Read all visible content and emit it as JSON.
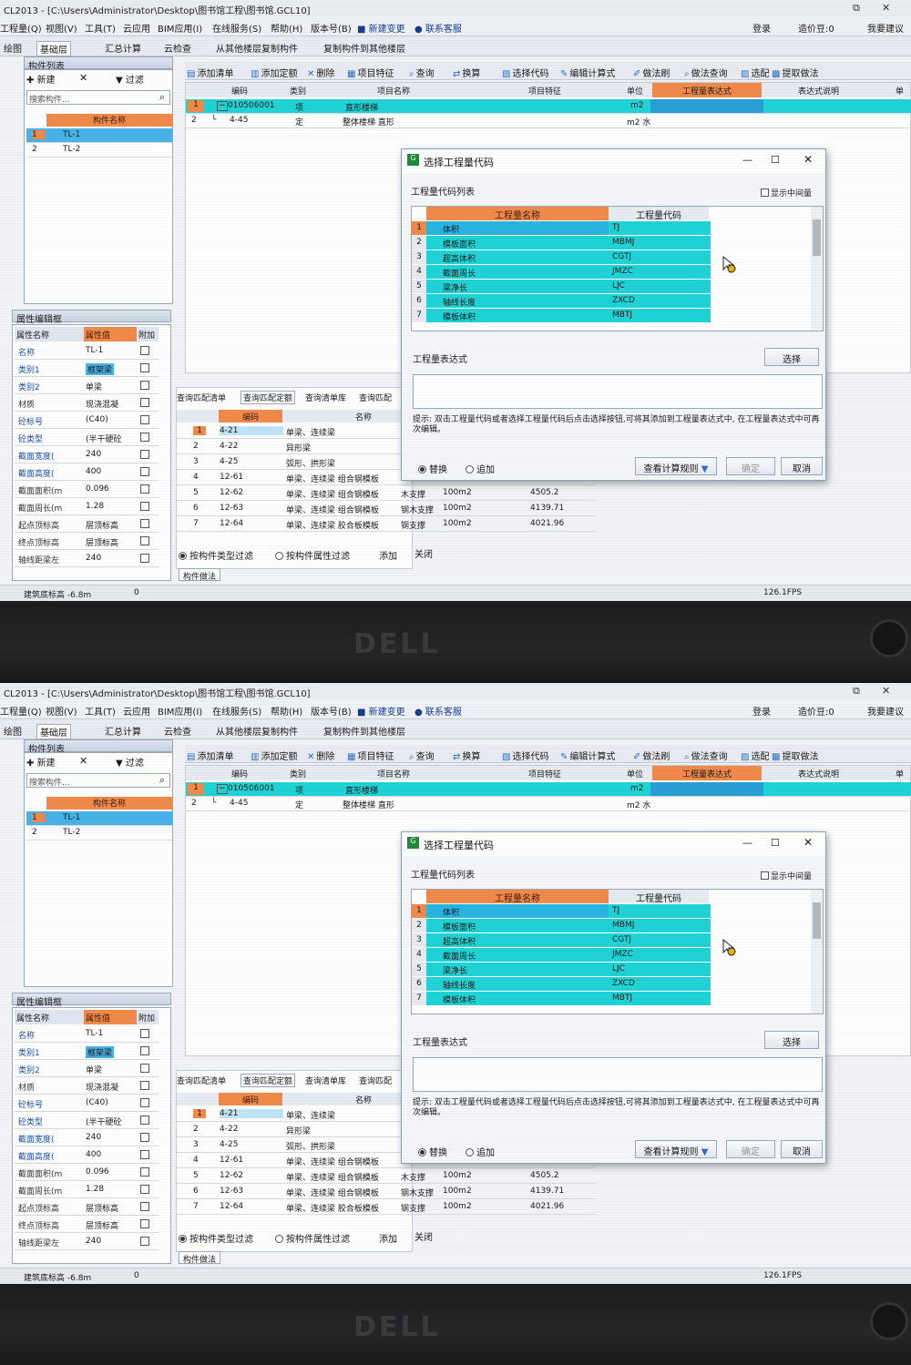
{
  "app": {
    "title": "CL2013 - [C:\\Users\\Administrator\\Desktop\\图书馆工程\\图书馆.GCL10]",
    "menus": [
      "工程量(Q)",
      "视图(V)",
      "工具(T)",
      "云应用",
      "BIM应用(I)",
      "在线服务(S)",
      "帮助(H)",
      "版本号(B)",
      "新建变更",
      "联系客服"
    ],
    "toolbar": {
      "draw": "绘图",
      "floor": "基础层",
      "sum": "汇总计算",
      "cloud_check": "云检查",
      "copy_from": "从其他楼层复制构件",
      "copy_to": "复制构件到其他楼层"
    },
    "account": {
      "login": "登录",
      "cost_beans": "造价豆:0",
      "feedback": "我要建议"
    }
  },
  "component_list": {
    "title": "构件列表",
    "new_label": "新建",
    "filter_label": "过滤",
    "search_placeholder": "搜索构件...",
    "column_header": "构件名称",
    "rows": [
      {
        "no": "1",
        "name": "TL-1"
      },
      {
        "no": "2",
        "name": "TL-2"
      }
    ]
  },
  "property_editor": {
    "title": "属性编辑框",
    "headers": {
      "name": "属性名称",
      "value": "属性值",
      "extra": "附加"
    },
    "rows": [
      {
        "name": "名称",
        "value": "TL-1"
      },
      {
        "name": "类别1",
        "value": "框架梁"
      },
      {
        "name": "类别2",
        "value": "单梁"
      },
      {
        "name": "材质",
        "value": "现浇混凝"
      },
      {
        "name": "砼标号",
        "value": "(C40)"
      },
      {
        "name": "砼类型",
        "value": "(半干硬砼"
      },
      {
        "name": "截面宽度(",
        "value": "240"
      },
      {
        "name": "截面高度(",
        "value": "400"
      },
      {
        "name": "截面面积(m",
        "value": "0.096"
      },
      {
        "name": "截面周长(m",
        "value": "1.28"
      },
      {
        "name": "起点顶标高",
        "value": "层顶标高"
      },
      {
        "name": "终点顶标高",
        "value": "层顶标高"
      },
      {
        "name": "轴线距梁左",
        "value": "240"
      }
    ]
  },
  "method_toolbar": [
    "添加清单",
    "添加定额",
    "删除",
    "项目特征",
    "查询",
    "换算",
    "选择代码",
    "编辑计算式",
    "做法刷",
    "做法查询",
    "选配",
    "提取做法"
  ],
  "method_grid": {
    "headers": [
      "编码",
      "类别",
      "项目名称",
      "项目特征",
      "单位",
      "工程量表达式",
      "表达式说明",
      "单价"
    ],
    "rows": [
      {
        "no": "1",
        "code": "010506001",
        "type": "项",
        "name": "直形楼梯",
        "unit": "m2"
      },
      {
        "no": "2",
        "code": "4-45",
        "type": "定",
        "name": "整体楼梯 直形",
        "unit": "m2 水"
      }
    ]
  },
  "query_panel": {
    "tabs": [
      "查询匹配清单",
      "查询匹配定额",
      "查询清单库",
      "查询匹配"
    ],
    "headers": [
      "编码",
      "名称"
    ],
    "rows": [
      {
        "no": "1",
        "code": "4-21",
        "name": "单梁、连续梁",
        "extra": "",
        "unit": "",
        "price": ""
      },
      {
        "no": "2",
        "code": "4-22",
        "name": "异形梁",
        "extra": "",
        "unit": "",
        "price": ""
      },
      {
        "no": "3",
        "code": "4-25",
        "name": "弧形、拱形梁",
        "extra": "",
        "unit": "",
        "price": ""
      },
      {
        "no": "4",
        "code": "12-61",
        "name": "单梁、连续梁 组合钢模板",
        "extra": "",
        "unit": "",
        "price": ""
      },
      {
        "no": "5",
        "code": "12-62",
        "name": "单梁、连续梁 组合钢模板",
        "extra": "木支撑",
        "unit": "100m2",
        "price": "4505.2"
      },
      {
        "no": "6",
        "code": "12-63",
        "name": "单梁、连续梁 组合钢模板",
        "extra": "钢木支撑",
        "unit": "100m2",
        "price": "4139.71"
      },
      {
        "no": "7",
        "code": "12-64",
        "name": "单梁、连续梁 胶合板模板",
        "extra": "钢支撑",
        "unit": "100m2",
        "price": "4021.96"
      }
    ],
    "filter_type": "按构件类型过滤",
    "filter_prop": "按构件属性过滤",
    "add": "添加",
    "close": "关闭",
    "bottom_tab": "构件做法"
  },
  "dialog": {
    "title": "选择工程量代码",
    "list_label": "工程量代码列表",
    "show_mid": "显示中间量",
    "headers": {
      "name": "工程量名称",
      "code": "工程量代码"
    },
    "rows": [
      {
        "no": "1",
        "name": "体积",
        "code": "TJ"
      },
      {
        "no": "2",
        "name": "模板面积",
        "code": "MBMJ"
      },
      {
        "no": "3",
        "name": "超高体积",
        "code": "CGTJ"
      },
      {
        "no": "4",
        "name": "截面周长",
        "code": "JMZC"
      },
      {
        "no": "5",
        "name": "梁净长",
        "code": "LJC"
      },
      {
        "no": "6",
        "name": "轴线长度",
        "code": "ZXCD"
      },
      {
        "no": "7",
        "name": "模板体积",
        "code": "MBTJ"
      }
    ],
    "expr_label": "工程量表达式",
    "select_btn": "选择",
    "hint": "提示: 双击工程量代码或者选择工程量代码后点击选择按钮,可将其添加到工程量表达式中, 在工程量表达式中可再次编辑。",
    "replace": "替换",
    "append": "追加",
    "rules_btn": "查看计算规则",
    "ok_btn": "确定",
    "cancel_btn": "取消"
  },
  "status": {
    "left": "建筑底标高 -6.8m",
    "zero": "0",
    "fps": "126.1FPS"
  },
  "bezel_brand": "DELL"
}
